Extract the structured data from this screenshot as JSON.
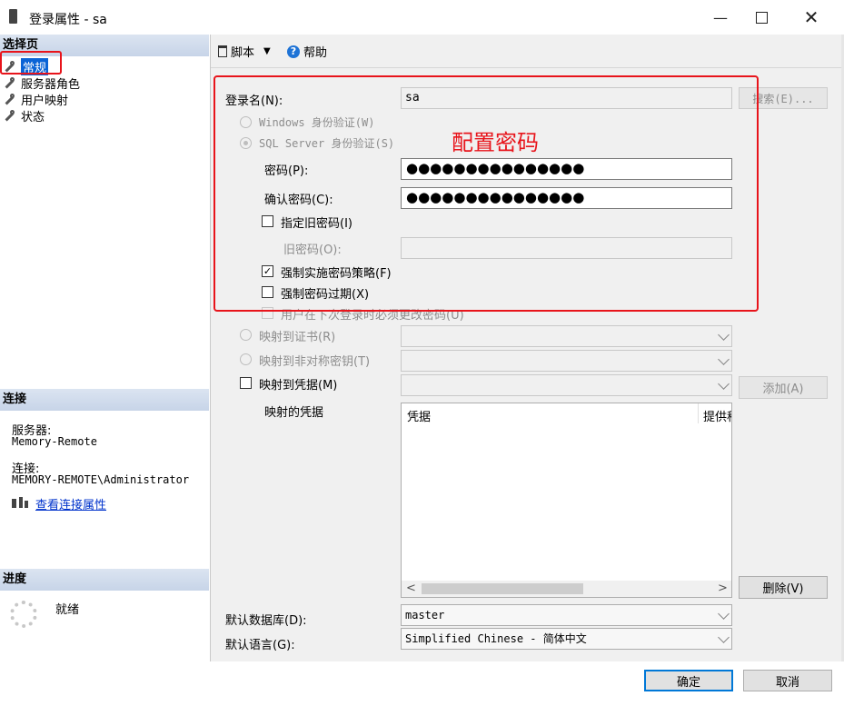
{
  "window": {
    "title": "登录属性 - sa"
  },
  "left": {
    "select_page_header": "选择页",
    "nav_items": [
      "常规",
      "服务器角色",
      "用户映射",
      "状态"
    ],
    "connection_header": "连接",
    "server_label": "服务器:",
    "server_value": "Memory-Remote",
    "connection_label": "连接:",
    "connection_value": "MEMORY-REMOTE\\Administrator",
    "view_link": "查看连接属性",
    "progress_header": "进度",
    "progress_status": "就绪"
  },
  "toolbar": {
    "script": "脚本",
    "help": "帮助"
  },
  "form": {
    "login_name_label": "登录名(N):",
    "login_name_value": "sa",
    "search_button": "搜索(E)...",
    "windows_auth": "Windows 身份验证(W)",
    "sql_auth": "SQL Server 身份验证(S)",
    "password_label": "密码(P):",
    "password_value": "●●●●●●●●●●●●●●●",
    "confirm_label": "确认密码(C):",
    "confirm_value": "●●●●●●●●●●●●●●●",
    "specify_old": "指定旧密码(I)",
    "old_password_label": "旧密码(O):",
    "enforce_policy": "强制实施密码策略(F)",
    "enforce_expiration": "强制密码过期(X)",
    "must_change": "用户在下次登录时必须更改密码(U)",
    "map_cert": "映射到证书(R)",
    "map_asym": "映射到非对称密钥(T)",
    "map_cred": "映射到凭据(M)",
    "add_button": "添加(A)",
    "mapped_cred_label": "映射的凭据",
    "cred_col": "凭据",
    "provider_col": "提供程",
    "delete_button": "删除(V)",
    "default_db_label": "默认数据库(D):",
    "default_db_value": "master",
    "default_lang_label": "默认语言(G):",
    "default_lang_value": "Simplified Chinese - 简体中文"
  },
  "annotation": "配置密码",
  "footer": {
    "ok": "确定",
    "cancel": "取消"
  },
  "colors": {
    "accent": "#0078d7",
    "selection": "#0a64d6",
    "annotation": "#e8141b"
  }
}
